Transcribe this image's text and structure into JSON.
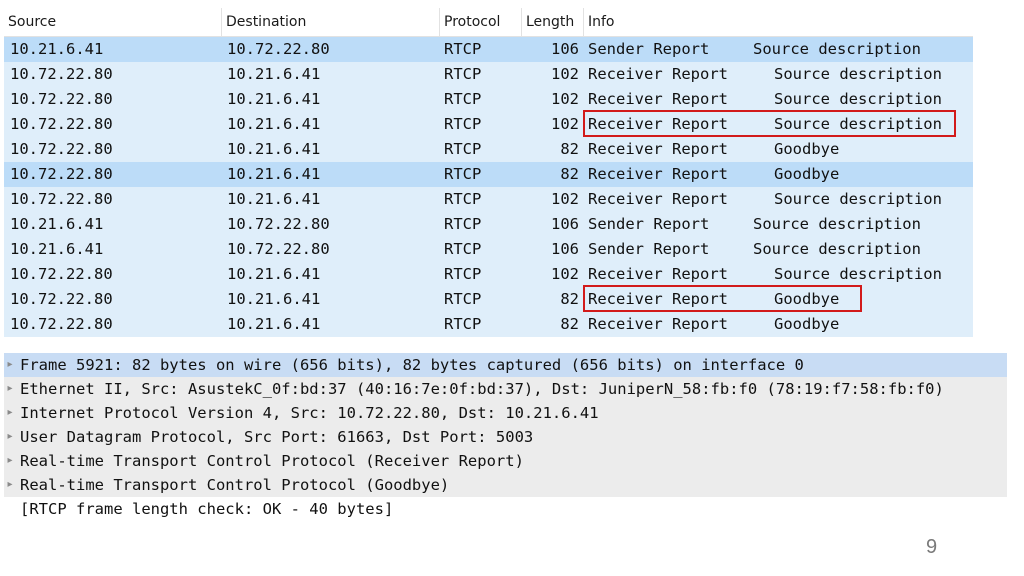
{
  "colors": {
    "row_default": "#dfeefa",
    "row_selected": "#bcdcf8",
    "detail_selected": "#c8dcf4",
    "detail_default": "#ececec",
    "highlight_box": "#d21a1a"
  },
  "packet_list": {
    "columns": [
      "Source",
      "Destination",
      "Protocol",
      "Length",
      "Info"
    ],
    "rows": [
      {
        "source": "10.21.6.41",
        "destination": "10.72.22.80",
        "protocol": "RTCP",
        "length": "106",
        "info_type": "Sender Report",
        "info_detail": "Source description",
        "selected": true
      },
      {
        "source": "10.72.22.80",
        "destination": "10.21.6.41",
        "protocol": "RTCP",
        "length": "102",
        "info_type": "Receiver Report",
        "info_detail": "Source description",
        "selected": false
      },
      {
        "source": "10.72.22.80",
        "destination": "10.21.6.41",
        "protocol": "RTCP",
        "length": "102",
        "info_type": "Receiver Report",
        "info_detail": "Source description",
        "selected": false
      },
      {
        "source": "10.72.22.80",
        "destination": "10.21.6.41",
        "protocol": "RTCP",
        "length": "102",
        "info_type": "Receiver Report",
        "info_detail": "Source description",
        "selected": false,
        "highlighted": true
      },
      {
        "source": "10.72.22.80",
        "destination": "10.21.6.41",
        "protocol": "RTCP",
        "length": "82",
        "info_type": "Receiver Report",
        "info_detail": "Goodbye",
        "selected": false
      },
      {
        "source": "10.72.22.80",
        "destination": "10.21.6.41",
        "protocol": "RTCP",
        "length": "82",
        "info_type": "Receiver Report",
        "info_detail": "Goodbye",
        "selected": true
      },
      {
        "source": "10.72.22.80",
        "destination": "10.21.6.41",
        "protocol": "RTCP",
        "length": "102",
        "info_type": "Receiver Report",
        "info_detail": "Source description",
        "selected": false
      },
      {
        "source": "10.21.6.41",
        "destination": "10.72.22.80",
        "protocol": "RTCP",
        "length": "106",
        "info_type": "Sender Report",
        "info_detail": "Source description",
        "selected": false
      },
      {
        "source": "10.21.6.41",
        "destination": "10.72.22.80",
        "protocol": "RTCP",
        "length": "106",
        "info_type": "Sender Report",
        "info_detail": "Source description",
        "selected": false
      },
      {
        "source": "10.72.22.80",
        "destination": "10.21.6.41",
        "protocol": "RTCP",
        "length": "102",
        "info_type": "Receiver Report",
        "info_detail": "Source description",
        "selected": false
      },
      {
        "source": "10.72.22.80",
        "destination": "10.21.6.41",
        "protocol": "RTCP",
        "length": "82",
        "info_type": "Receiver Report",
        "info_detail": "Goodbye",
        "selected": false,
        "highlighted": true
      },
      {
        "source": "10.72.22.80",
        "destination": "10.21.6.41",
        "protocol": "RTCP",
        "length": "82",
        "info_type": "Receiver Report",
        "info_detail": "Goodbye",
        "selected": false
      }
    ]
  },
  "packet_details": [
    {
      "text": "Frame 5921: 82 bytes on wire (656 bits), 82 bytes captured (656 bits) on interface 0",
      "expandable": true,
      "selected": true
    },
    {
      "text": "Ethernet II, Src: AsustekC_0f:bd:37 (40:16:7e:0f:bd:37), Dst: JuniperN_58:fb:f0 (78:19:f7:58:fb:f0)",
      "expandable": true,
      "selected": false
    },
    {
      "text": "Internet Protocol Version 4, Src: 10.72.22.80, Dst: 10.21.6.41",
      "expandable": true,
      "selected": false
    },
    {
      "text": "User Datagram Protocol, Src Port: 61663, Dst Port: 5003",
      "expandable": true,
      "selected": false
    },
    {
      "text": "Real-time Transport Control Protocol (Receiver Report)",
      "expandable": true,
      "selected": false
    },
    {
      "text": "Real-time Transport Control Protocol (Goodbye)",
      "expandable": true,
      "selected": false
    },
    {
      "text": "[RTCP frame length check: OK - 40 bytes]",
      "expandable": false,
      "selected": false
    }
  ],
  "page_number": "9"
}
